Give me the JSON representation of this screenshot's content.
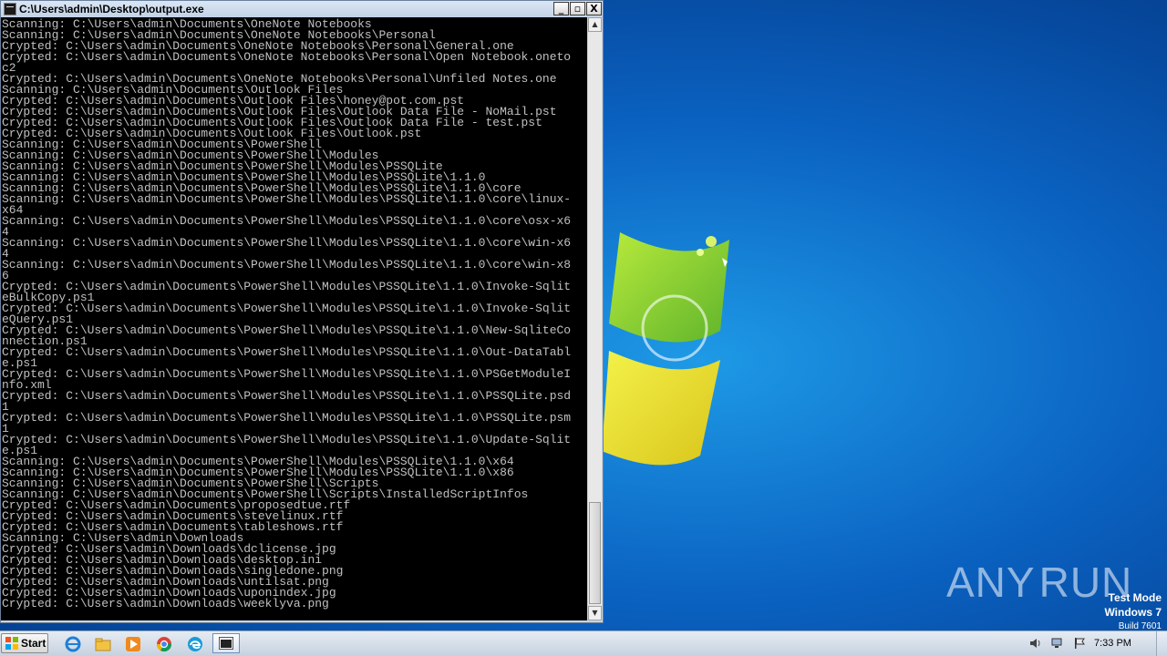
{
  "window": {
    "title": "C:\\Users\\admin\\Desktop\\output.exe",
    "minimize": "_",
    "maximize": "▫",
    "close": "X"
  },
  "console": {
    "lines": [
      "Scanning: C:\\Users\\admin\\Documents\\OneNote Notebooks",
      "Scanning: C:\\Users\\admin\\Documents\\OneNote Notebooks\\Personal",
      "Crypted: C:\\Users\\admin\\Documents\\OneNote Notebooks\\Personal\\General.one",
      "Crypted: C:\\Users\\admin\\Documents\\OneNote Notebooks\\Personal\\Open Notebook.oneto",
      "c2",
      "Crypted: C:\\Users\\admin\\Documents\\OneNote Notebooks\\Personal\\Unfiled Notes.one",
      "Scanning: C:\\Users\\admin\\Documents\\Outlook Files",
      "Crypted: C:\\Users\\admin\\Documents\\Outlook Files\\honey@pot.com.pst",
      "Crypted: C:\\Users\\admin\\Documents\\Outlook Files\\Outlook Data File - NoMail.pst",
      "Crypted: C:\\Users\\admin\\Documents\\Outlook Files\\Outlook Data File - test.pst",
      "Crypted: C:\\Users\\admin\\Documents\\Outlook Files\\Outlook.pst",
      "Scanning: C:\\Users\\admin\\Documents\\PowerShell",
      "Scanning: C:\\Users\\admin\\Documents\\PowerShell\\Modules",
      "Scanning: C:\\Users\\admin\\Documents\\PowerShell\\Modules\\PSSQLite",
      "Scanning: C:\\Users\\admin\\Documents\\PowerShell\\Modules\\PSSQLite\\1.1.0",
      "Scanning: C:\\Users\\admin\\Documents\\PowerShell\\Modules\\PSSQLite\\1.1.0\\core",
      "Scanning: C:\\Users\\admin\\Documents\\PowerShell\\Modules\\PSSQLite\\1.1.0\\core\\linux-",
      "x64",
      "Scanning: C:\\Users\\admin\\Documents\\PowerShell\\Modules\\PSSQLite\\1.1.0\\core\\osx-x6",
      "4",
      "Scanning: C:\\Users\\admin\\Documents\\PowerShell\\Modules\\PSSQLite\\1.1.0\\core\\win-x6",
      "4",
      "Scanning: C:\\Users\\admin\\Documents\\PowerShell\\Modules\\PSSQLite\\1.1.0\\core\\win-x8",
      "6",
      "Crypted: C:\\Users\\admin\\Documents\\PowerShell\\Modules\\PSSQLite\\1.1.0\\Invoke-Sqlit",
      "eBulkCopy.ps1",
      "Crypted: C:\\Users\\admin\\Documents\\PowerShell\\Modules\\PSSQLite\\1.1.0\\Invoke-Sqlit",
      "eQuery.ps1",
      "Crypted: C:\\Users\\admin\\Documents\\PowerShell\\Modules\\PSSQLite\\1.1.0\\New-SqliteCo",
      "nnection.ps1",
      "Crypted: C:\\Users\\admin\\Documents\\PowerShell\\Modules\\PSSQLite\\1.1.0\\Out-DataTabl",
      "e.ps1",
      "Crypted: C:\\Users\\admin\\Documents\\PowerShell\\Modules\\PSSQLite\\1.1.0\\PSGetModuleI",
      "nfo.xml",
      "Crypted: C:\\Users\\admin\\Documents\\PowerShell\\Modules\\PSSQLite\\1.1.0\\PSSQLite.psd",
      "1",
      "Crypted: C:\\Users\\admin\\Documents\\PowerShell\\Modules\\PSSQLite\\1.1.0\\PSSQLite.psm",
      "1",
      "Crypted: C:\\Users\\admin\\Documents\\PowerShell\\Modules\\PSSQLite\\1.1.0\\Update-Sqlit",
      "e.ps1",
      "Scanning: C:\\Users\\admin\\Documents\\PowerShell\\Modules\\PSSQLite\\1.1.0\\x64",
      "Scanning: C:\\Users\\admin\\Documents\\PowerShell\\Modules\\PSSQLite\\1.1.0\\x86",
      "Scanning: C:\\Users\\admin\\Documents\\PowerShell\\Scripts",
      "Scanning: C:\\Users\\admin\\Documents\\PowerShell\\Scripts\\InstalledScriptInfos",
      "Crypted: C:\\Users\\admin\\Documents\\proposedtue.rtf",
      "Crypted: C:\\Users\\admin\\Documents\\stevelinux.rtf",
      "Crypted: C:\\Users\\admin\\Documents\\tableshows.rtf",
      "Scanning: C:\\Users\\admin\\Downloads",
      "Crypted: C:\\Users\\admin\\Downloads\\dclicense.jpg",
      "Crypted: C:\\Users\\admin\\Downloads\\desktop.ini",
      "Crypted: C:\\Users\\admin\\Downloads\\singledone.png",
      "Crypted: C:\\Users\\admin\\Downloads\\untilsat.png",
      "Crypted: C:\\Users\\admin\\Downloads\\uponindex.jpg",
      "Crypted: C:\\Users\\admin\\Downloads\\weeklyva.png"
    ]
  },
  "desktop": {
    "watermark_left": "ANY",
    "watermark_right": "RUN",
    "test_mode": "Test Mode",
    "os_name": "Windows 7",
    "build": "Build 7601"
  },
  "taskbar": {
    "start_label": "Start",
    "clock": "7:33 PM",
    "pinned_icons": [
      "internet-explorer-icon",
      "file-explorer-icon",
      "media-player-icon",
      "chrome-icon",
      "edge-icon"
    ],
    "tray_icons": [
      "speaker-icon",
      "network-icon",
      "action-center-flag-icon"
    ]
  },
  "colors": {
    "console_bg": "#000000",
    "console_text": "#c0c0c0",
    "desktop_blue": "#0b63c2"
  }
}
